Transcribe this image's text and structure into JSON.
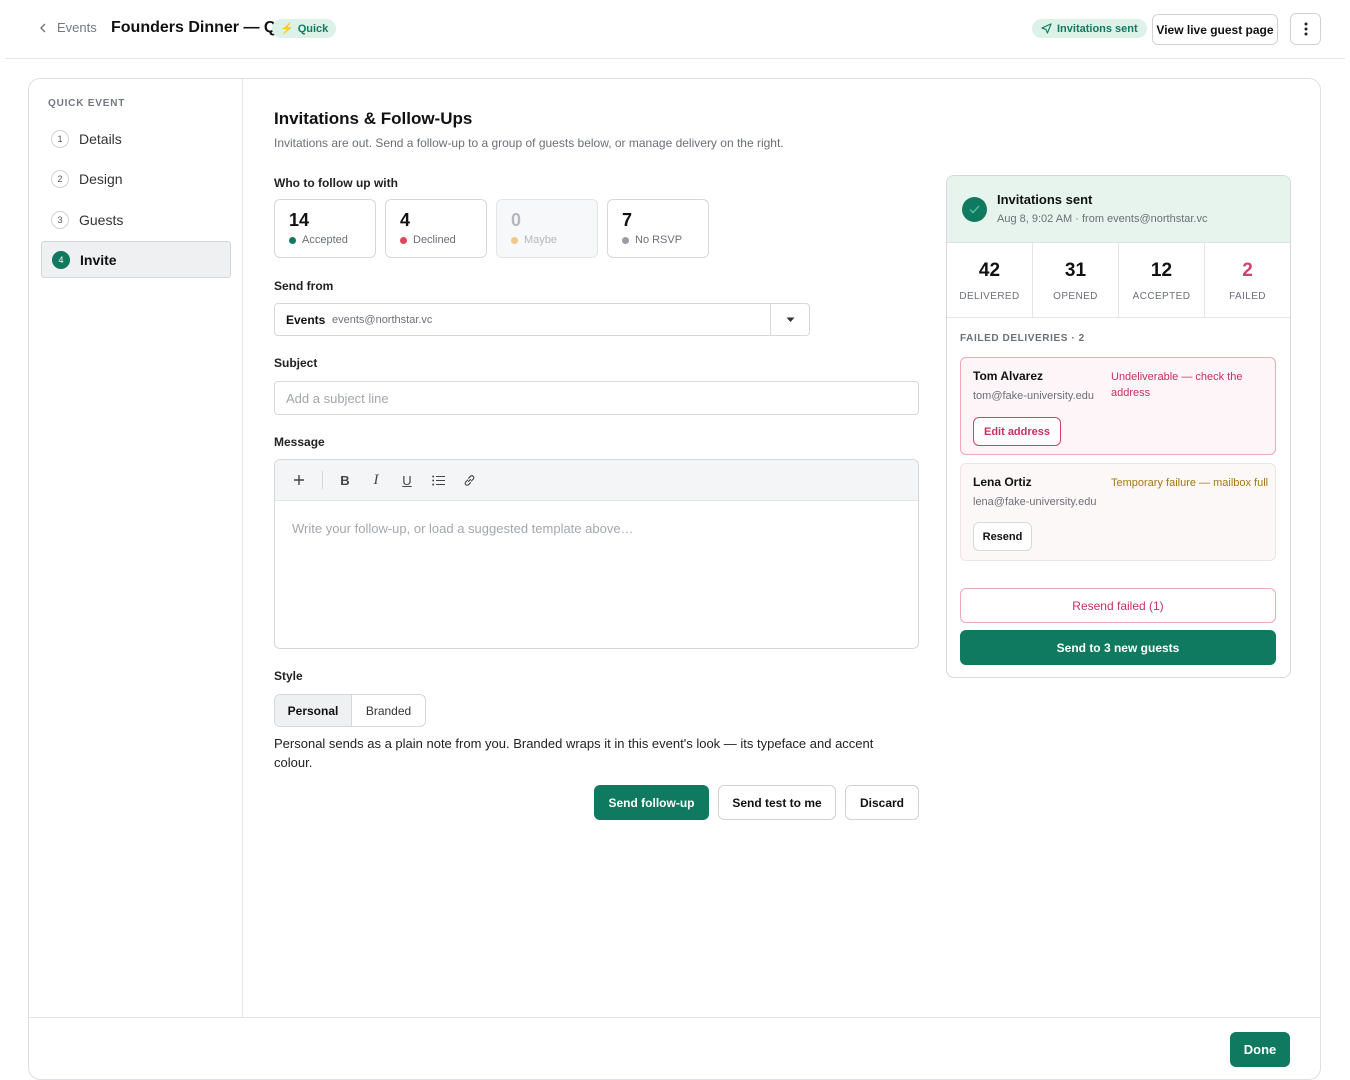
{
  "header": {
    "back_label": "Events",
    "title": "Founders Dinner — Q3",
    "badge": "Quick",
    "status_pill": "Invitations sent",
    "view_live_label": "View live guest page"
  },
  "sidebar": {
    "title": "QUICK EVENT",
    "steps": [
      {
        "num": "1",
        "label": "Details"
      },
      {
        "num": "2",
        "label": "Design"
      },
      {
        "num": "3",
        "label": "Guests"
      },
      {
        "num": "4",
        "label": "Invite"
      }
    ],
    "active_step": "Invite"
  },
  "main": {
    "heading": "Invitations & Follow-Ups",
    "subheading": "Invitations are out. Send a follow-up to a group of guests below, or manage delivery on the right.",
    "follow_up_label": "Who to follow up with",
    "rsvp_groups": [
      {
        "count": "14",
        "label": "Accepted",
        "color": "#0f7a5f"
      },
      {
        "count": "4",
        "label": "Declined",
        "color": "#e0445d"
      },
      {
        "count": "0",
        "label": "Maybe",
        "color": "#f2c78a"
      },
      {
        "count": "7",
        "label": "No RSVP",
        "color": "#9a9ea4"
      }
    ],
    "send_from_label": "Send from",
    "send_from_name": "Events",
    "send_from_address": "events@northstar.vc",
    "subject_label": "Subject",
    "subject_placeholder": "Add a subject line",
    "subject_value": "",
    "message_label": "Message",
    "message_placeholder": "Write your follow-up, or load a suggested template above…",
    "style_label": "Style",
    "style_options": [
      "Personal",
      "Branded"
    ],
    "style_selected": "Personal",
    "style_note": "Personal sends as a plain note from you. Branded wraps it in this event's look — its typeface and accent colour.",
    "send_followup_label": "Send follow-up",
    "send_test_label": "Send test to me",
    "discard_label": "Discard"
  },
  "delivery": {
    "title": "Invitations sent",
    "subtitle": "Aug 8, 9:02 AM · from events@northstar.vc",
    "stats": [
      {
        "value": "42",
        "label": "DELIVERED"
      },
      {
        "value": "31",
        "label": "OPENED"
      },
      {
        "value": "12",
        "label": "ACCEPTED"
      },
      {
        "value": "2",
        "label": "FAILED"
      }
    ],
    "failed_title": "FAILED DELIVERIES · 2",
    "failed": [
      {
        "name": "Tom Alvarez",
        "email": "tom@fake-university.edu",
        "reason": "Undeliverable — check the address",
        "action": "Edit address"
      },
      {
        "name": "Lena Ortiz",
        "email": "lena@fake-university.edu",
        "reason": "Temporary failure — mailbox full",
        "action": "Resend"
      }
    ],
    "resend_failed_label": "Resend failed (1)",
    "send_new_label": "Send to 3 new guests"
  },
  "footer": {
    "done_label": "Done"
  },
  "colors": {
    "accent": "#0f7a5f",
    "danger": "#d1426b",
    "warning": "#a37812"
  }
}
